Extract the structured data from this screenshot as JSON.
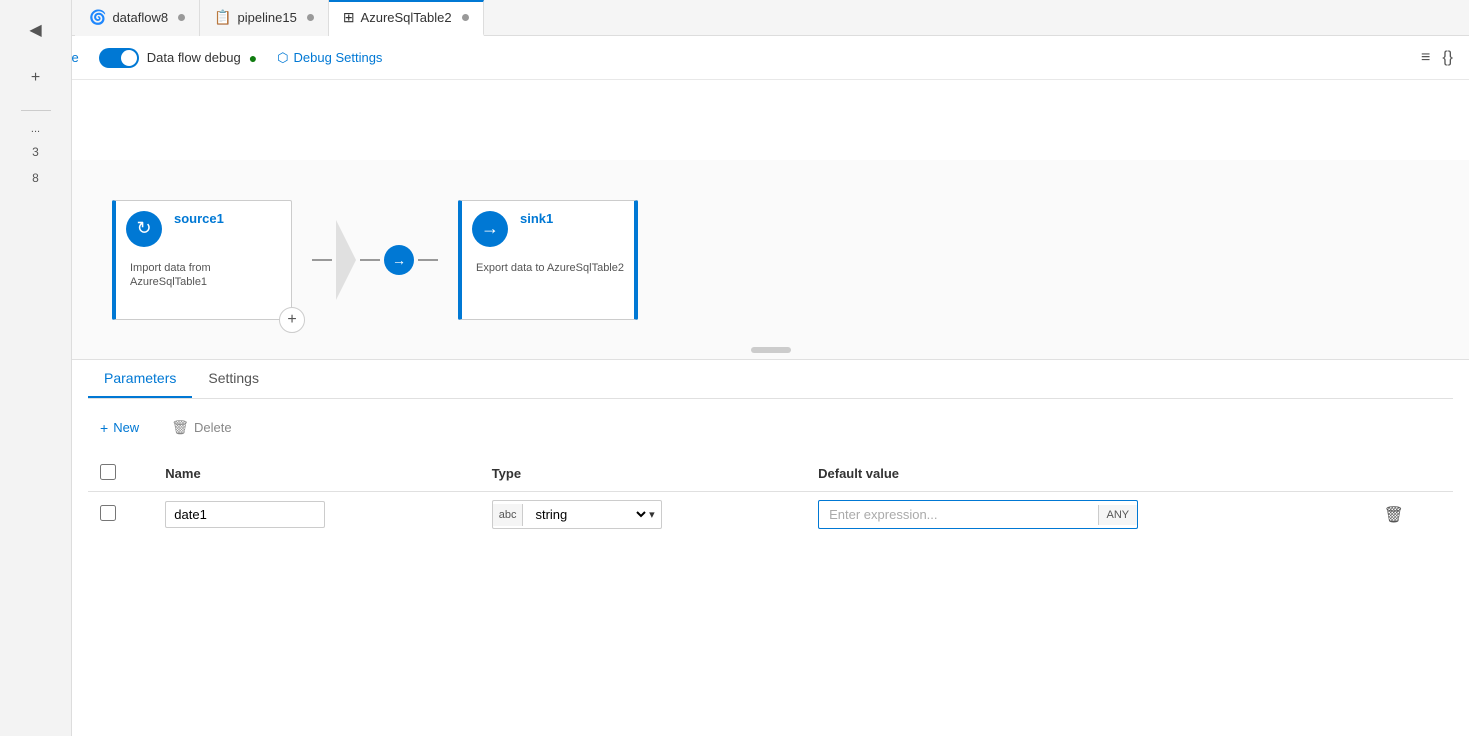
{
  "tabs": [
    {
      "id": "dataflow8",
      "label": "dataflow8",
      "icon": "🌀",
      "active": false,
      "dot": true
    },
    {
      "id": "pipeline15",
      "label": "pipeline15",
      "icon": "📋",
      "active": false,
      "dot": true
    },
    {
      "id": "azuresqltable2",
      "label": "AzureSqlTable2",
      "icon": "⊞",
      "active": true,
      "dot": true
    }
  ],
  "toolbar": {
    "validate_label": "Validate",
    "debug_label": "Data flow debug",
    "debug_settings_label": "Debug Settings"
  },
  "canvas": {
    "source_node": {
      "title": "source1",
      "subtitle": "Import data from\nAzureSqlTable1"
    },
    "sink_node": {
      "title": "sink1",
      "subtitle": "Export data to AzureSqlTable2"
    }
  },
  "panel": {
    "tabs": [
      {
        "label": "Parameters",
        "active": true
      },
      {
        "label": "Settings",
        "active": false
      }
    ],
    "new_btn": "New",
    "delete_btn": "Delete",
    "table": {
      "headers": [
        "Name",
        "Type",
        "Default value"
      ],
      "rows": [
        {
          "name": "date1",
          "type_prefix": "abc",
          "type_value": "string",
          "default_placeholder": "Enter expression..."
        }
      ]
    }
  },
  "line_numbers": [
    "...",
    "3",
    "8"
  ],
  "icons": {
    "validate_check": "✓",
    "new_plus": "+",
    "delete_trash": "🗑",
    "chevron_down": "▾",
    "debug_settings_icon": "⬡",
    "toolbar_list": "≡",
    "toolbar_code": "{}",
    "source_icon": "↻",
    "sink_icon": "→"
  }
}
